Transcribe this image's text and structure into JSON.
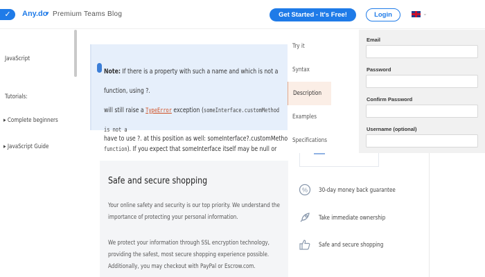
{
  "header": {
    "logo_icon": "checkmark-icon",
    "brand": "Any.do",
    "brand_chevron": "▾",
    "subtitle": "Premium  Teams  Blog",
    "get_started": "Get Started - It's Free!",
    "login": "Login",
    "lang_icon": "uk-flag-icon",
    "lang_chevron": "⌄"
  },
  "sidebar": {
    "javascript": "JavaScript",
    "tutorials": "Tutorials:",
    "items": [
      "▸ Complete beginners",
      "▸ JavaScript Guide"
    ]
  },
  "note": {
    "label": "Note:",
    "line1": "If there is a property with such a name and which is not a function, using ?.",
    "line2a": "will still raise a",
    "link": "TypeError",
    "line2b": "exception (",
    "code1": "someInterface.customMethod is not a",
    "code2": "function",
    "line3": "). If you expect that someInterface itself may be null or undefined, you",
    "after": "have to use ?. at this position as well: someInterface?.customMethod?.()"
  },
  "secure": {
    "title": "Safe and secure shopping",
    "p1": "Your online safety and security is our top priority. We understand the importance of protecting your personal information.",
    "p2": "We protect your information through SSL encryption technology, providing the safest, most secure shopping experience possible. Additionally, you may checkout with PayPal or Escrow.com."
  },
  "sections": {
    "items": [
      "Try it",
      "Syntax",
      "Description",
      "Examples",
      "Specifications"
    ],
    "active": "Description"
  },
  "form": {
    "email_label": "Email",
    "password_label": "Password",
    "confirm_label": "Confirm Password",
    "username_label": "Username (optional)"
  },
  "features": {
    "items": [
      {
        "icon": "percent-circle-icon",
        "text": "30-day money back guarantee"
      },
      {
        "icon": "rocket-icon",
        "text": "Take immediate ownership"
      },
      {
        "icon": "thumbs-up-icon",
        "text": "Safe and secure shopping"
      }
    ]
  },
  "colors": {
    "accent": "#1f7be8",
    "note_bg": "#e6effb",
    "link": "#d04f22",
    "active_section_bg": "#fbeee6"
  }
}
